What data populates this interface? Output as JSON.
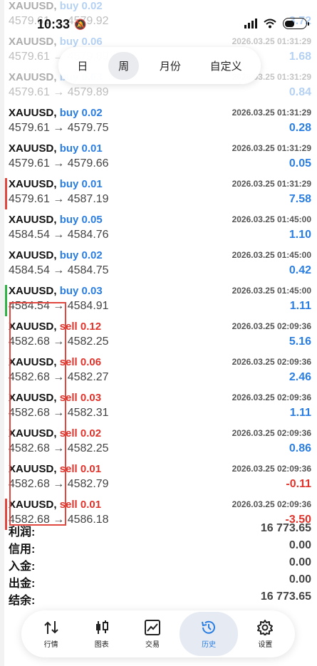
{
  "status_bar": {
    "time": "10:33"
  },
  "period_tabs": [
    "日",
    "周",
    "月份",
    "自定义"
  ],
  "period_active": "周",
  "deals": [
    {
      "symbol": "XAUUSD,",
      "dir": "buy",
      "vol": "0.02",
      "prices": "4579.61 → 4579.92",
      "time": "",
      "pnl": "3.72",
      "sign": "pos",
      "faded": true,
      "marker": ""
    },
    {
      "symbol": "XAUUSD,",
      "dir": "buy",
      "vol": "0.06",
      "prices": "4579.61 → 4579.89",
      "time": "2026.03.25 01:31:29",
      "pnl": "1.68",
      "sign": "pos",
      "faded": true,
      "marker": ""
    },
    {
      "symbol": "XAUUSD,",
      "dir": "buy",
      "vol": "0.03",
      "prices": "4579.61 → 4579.89",
      "time": "2026.03.25 01:31:29",
      "pnl": "0.84",
      "sign": "pos",
      "faded": true,
      "marker": ""
    },
    {
      "symbol": "XAUUSD,",
      "dir": "buy",
      "vol": "0.02",
      "prices": "4579.61 → 4579.75",
      "time": "2026.03.25 01:31:29",
      "pnl": "0.28",
      "sign": "pos",
      "faded": false,
      "marker": ""
    },
    {
      "symbol": "XAUUSD,",
      "dir": "buy",
      "vol": "0.01",
      "prices": "4579.61 → 4579.66",
      "time": "2026.03.25 01:31:29",
      "pnl": "0.05",
      "sign": "pos",
      "faded": false,
      "marker": ""
    },
    {
      "symbol": "XAUUSD,",
      "dir": "buy",
      "vol": "0.01",
      "prices": "4579.61 → 4587.19",
      "time": "2026.03.25 01:31:29",
      "pnl": "7.58",
      "sign": "pos",
      "faded": false,
      "marker": "#e0473f"
    },
    {
      "symbol": "XAUUSD,",
      "dir": "buy",
      "vol": "0.05",
      "prices": "4584.54 → 4584.76",
      "time": "2026.03.25 01:45:00",
      "pnl": "1.10",
      "sign": "pos",
      "faded": false,
      "marker": ""
    },
    {
      "symbol": "XAUUSD,",
      "dir": "buy",
      "vol": "0.02",
      "prices": "4584.54 → 4584.75",
      "time": "2026.03.25 01:45:00",
      "pnl": "0.42",
      "sign": "pos",
      "faded": false,
      "marker": ""
    },
    {
      "symbol": "XAUUSD,",
      "dir": "buy",
      "vol": "0.03",
      "prices": "4584.54 → 4584.91",
      "time": "2026.03.25 01:45:00",
      "pnl": "1.11",
      "sign": "pos",
      "faded": false,
      "marker": "#2fb344"
    },
    {
      "symbol": "XAUUSD,",
      "dir": "sell",
      "vol": "0.12",
      "prices": "4582.68 → 4582.25",
      "time": "2026.03.25 02:09:36",
      "pnl": "5.16",
      "sign": "pos",
      "faded": false,
      "marker": ""
    },
    {
      "symbol": "XAUUSD,",
      "dir": "sell",
      "vol": "0.06",
      "prices": "4582.68 → 4582.27",
      "time": "2026.03.25 02:09:36",
      "pnl": "2.46",
      "sign": "pos",
      "faded": false,
      "marker": ""
    },
    {
      "symbol": "XAUUSD,",
      "dir": "sell",
      "vol": "0.03",
      "prices": "4582.68 → 4582.31",
      "time": "2026.03.25 02:09:36",
      "pnl": "1.11",
      "sign": "pos",
      "faded": false,
      "marker": ""
    },
    {
      "symbol": "XAUUSD,",
      "dir": "sell",
      "vol": "0.02",
      "prices": "4582.68 → 4582.25",
      "time": "2026.03.25 02:09:36",
      "pnl": "0.86",
      "sign": "pos",
      "faded": false,
      "marker": ""
    },
    {
      "symbol": "XAUUSD,",
      "dir": "sell",
      "vol": "0.01",
      "prices": "4582.68 → 4582.79",
      "time": "2026.03.25 02:09:36",
      "pnl": "-0.11",
      "sign": "neg",
      "faded": false,
      "marker": ""
    },
    {
      "symbol": "XAUUSD,",
      "dir": "sell",
      "vol": "0.01",
      "prices": "4582.68 → 4586.18",
      "time": "2026.03.25 02:09:36",
      "pnl": "-3.50",
      "sign": "neg",
      "faded": false,
      "marker": "#e0473f"
    }
  ],
  "summary": [
    {
      "label": "利润:",
      "value": "16 773.65"
    },
    {
      "label": "信用:",
      "value": "0.00"
    },
    {
      "label": "入金:",
      "value": "0.00"
    },
    {
      "label": "出金:",
      "value": "0.00"
    },
    {
      "label": "结余:",
      "value": "16 773.65"
    }
  ],
  "nav": [
    {
      "label": "行情",
      "icon": "quotes-icon"
    },
    {
      "label": "图表",
      "icon": "chart-icon"
    },
    {
      "label": "交易",
      "icon": "trade-icon"
    },
    {
      "label": "历史",
      "icon": "history-icon"
    },
    {
      "label": "设置",
      "icon": "settings-icon"
    }
  ],
  "nav_active": "历史",
  "colors": {
    "buy": "#2a7de1",
    "sell": "#e0332b",
    "accent": "#2a7de1",
    "highlight": "#e0473f"
  }
}
